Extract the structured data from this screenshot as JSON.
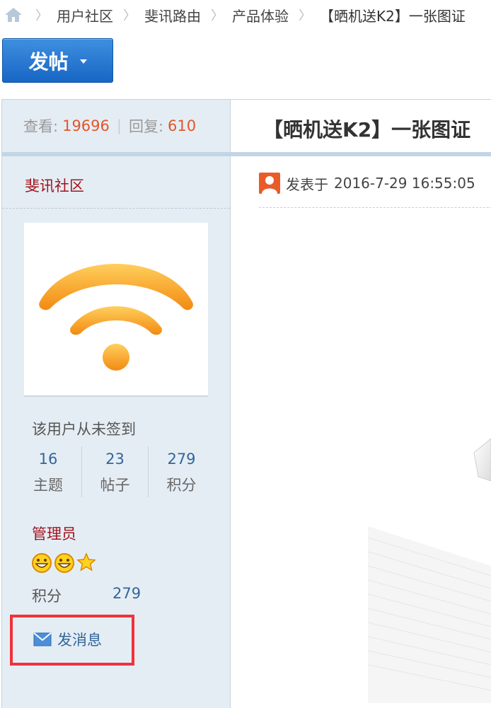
{
  "breadcrumb": {
    "items": [
      "用户社区",
      "斐讯路由",
      "产品体验"
    ],
    "current": "【晒机送K2】一张图证"
  },
  "post_button": {
    "label": "发帖"
  },
  "thread": {
    "views_label": "查看:",
    "views": "19696",
    "replies_label": "回复:",
    "replies": "610",
    "title": "【晒机送K2】一张图证"
  },
  "author": {
    "name": "斐讯社区",
    "signin_status": "该用户从未签到",
    "stats": [
      {
        "value": "16",
        "label": "主题"
      },
      {
        "value": "23",
        "label": "帖子"
      },
      {
        "value": "279",
        "label": "积分"
      }
    ],
    "role": "管理员",
    "score_label": "积分",
    "score_value": "279",
    "message_label": "发消息"
  },
  "post": {
    "posted_prefix": "发表于",
    "posted_time": "2016-7-29 16:55:05"
  },
  "colors": {
    "accent_red": "#a1121c",
    "number_orange": "#e2562b",
    "link_blue": "#336699",
    "button_blue": "#1766c4",
    "highlight_red": "#f0323a"
  }
}
